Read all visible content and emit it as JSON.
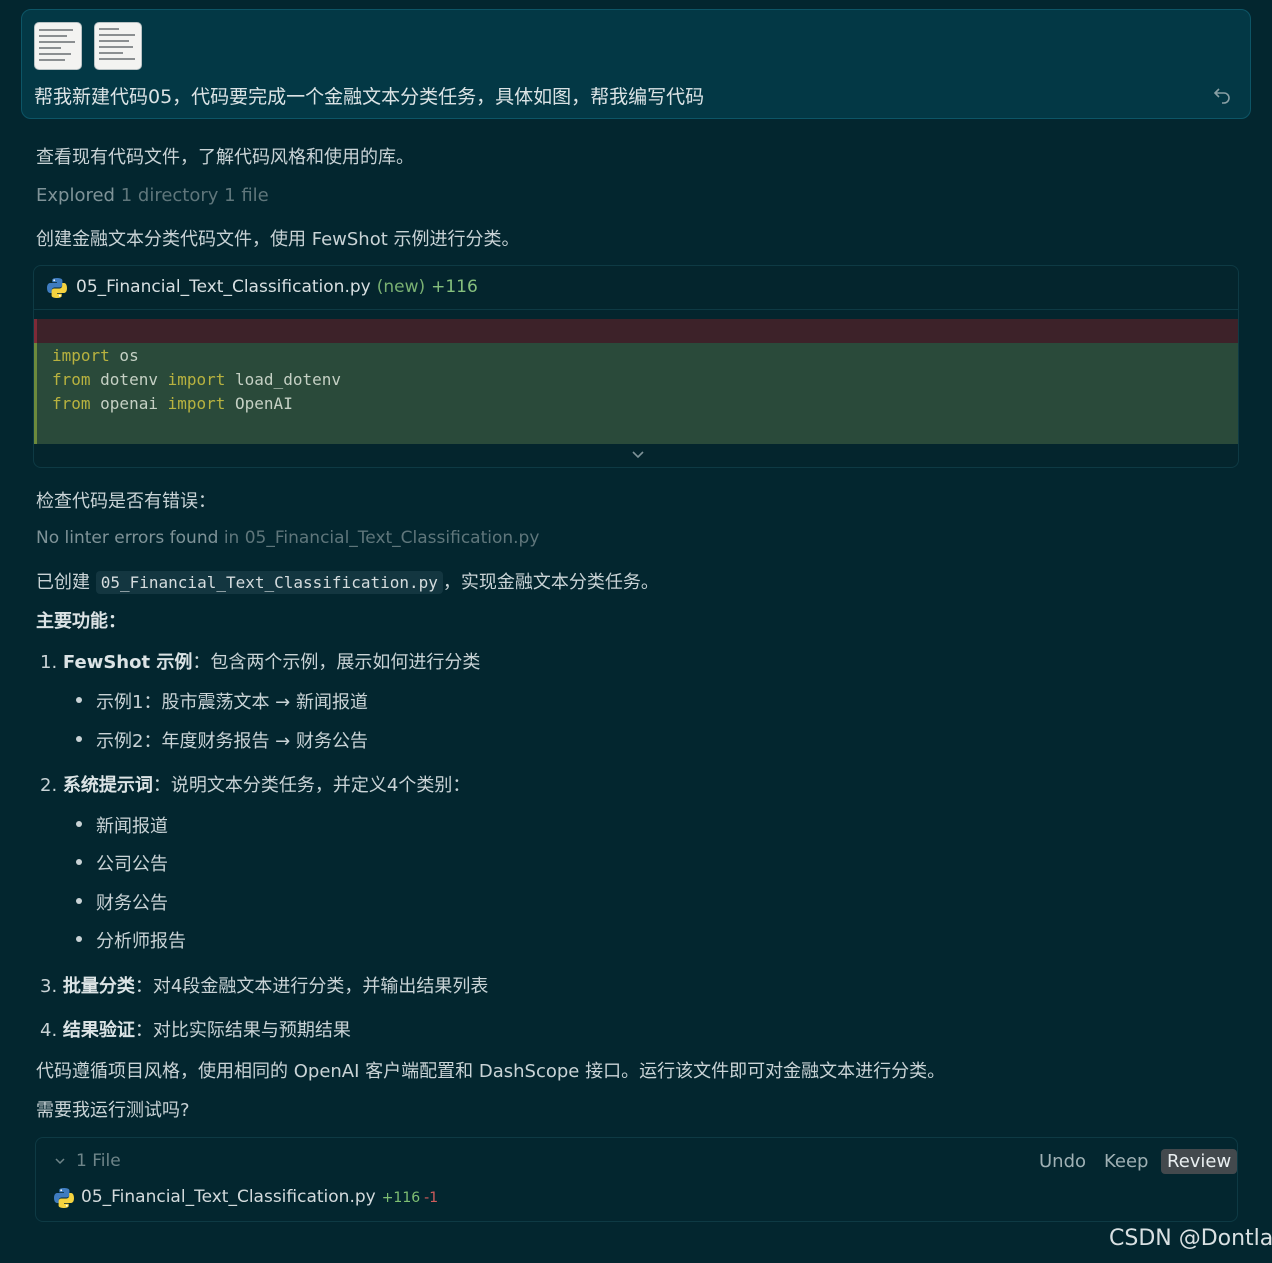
{
  "user_message": {
    "text": "帮我新建代码05，代码要完成一个金融文本分类任务，具体如图，帮我编写代码",
    "attachments": [
      "image-thumbnail",
      "image-thumbnail"
    ],
    "action_icon": "return-arrow-icon"
  },
  "assistant": {
    "step1": "查看现有代码文件，了解代码风格和使用的库。",
    "explored_label": "Explored",
    "explored_detail": "1 directory 1 file",
    "step2": "创建金融文本分类代码文件，使用 FewShot 示例进行分类。",
    "code_card": {
      "filename": "05_Financial_Text_Classification.py",
      "status": "(new)",
      "additions": "+116",
      "lines": [
        {
          "kw1": "import",
          "rest1": " os",
          "kw2": "",
          "rest2": ""
        },
        {
          "kw1": "from",
          "rest1": " dotenv ",
          "kw2": "import",
          "rest2": " load_dotenv"
        },
        {
          "kw1": "from",
          "rest1": " openai ",
          "kw2": "import",
          "rest2": " OpenAI"
        }
      ]
    },
    "step3": "检查代码是否有错误：",
    "lint_result": "No linter errors found",
    "lint_where": "in 05_Financial_Text_Classification.py",
    "created_prefix": "已创建",
    "created_file": "05_Financial_Text_Classification.py",
    "created_suffix": "，实现金融文本分类任务。",
    "features_title": "主要功能：",
    "features": [
      {
        "num": "1.",
        "title": "FewShot 示例",
        "desc": "：包含两个示例，展示如何进行分类",
        "bullets": [
          "示例1：股市震荡文本 → 新闻报道",
          "示例2：年度财务报告 → 财务公告"
        ]
      },
      {
        "num": "2.",
        "title": "系统提示词",
        "desc": "：说明文本分类任务，并定义4个类别：",
        "bullets": [
          "新闻报道",
          "公司公告",
          "财务公告",
          "分析师报告"
        ]
      },
      {
        "num": "3.",
        "title": "批量分类",
        "desc": "：对4段金融文本进行分类，并输出结果列表",
        "bullets": []
      },
      {
        "num": "4.",
        "title": "结果验证",
        "desc": "：对比实际结果与预期结果",
        "bullets": []
      }
    ],
    "closing": "代码遵循项目风格，使用相同的 OpenAI 客户端配置和 DashScope 接口。运行该文件即可对金融文本进行分类。",
    "question": "需要我运行测试吗?"
  },
  "files_panel": {
    "label": "1 File",
    "undo": "Undo",
    "keep": "Keep",
    "review": "Review",
    "file": "05_Financial_Text_Classification.py",
    "added": "+116",
    "removed": "-1"
  },
  "watermark": "CSDN @Dontla"
}
